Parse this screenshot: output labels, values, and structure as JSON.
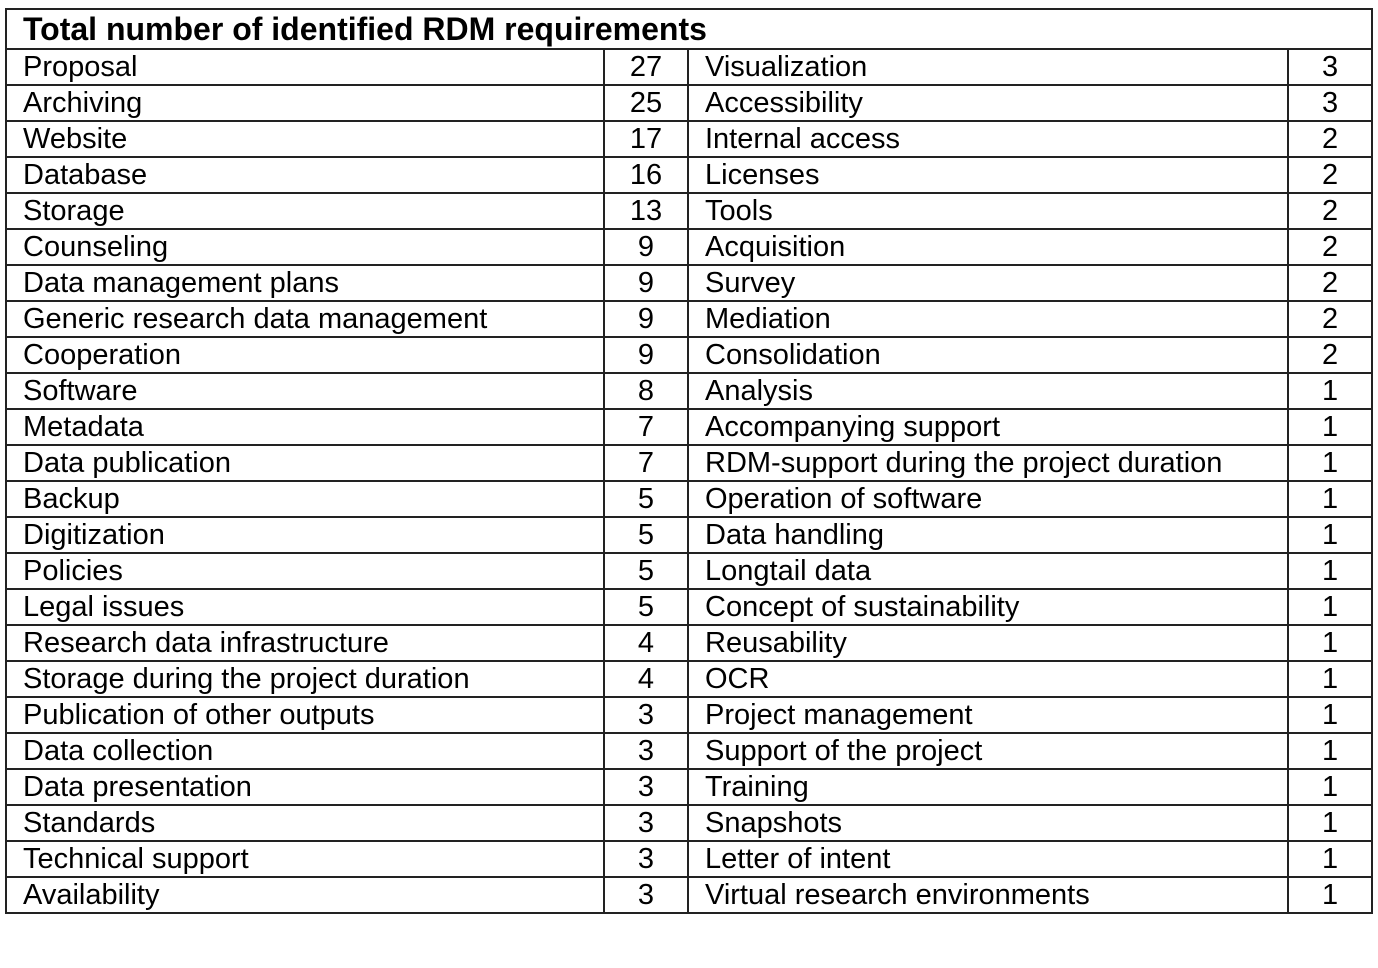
{
  "table": {
    "title": "Total number of identified RDM requirements",
    "rows": [
      {
        "left_label": "Proposal",
        "left_value": "27",
        "right_label": "Visualization",
        "right_value": "3"
      },
      {
        "left_label": "Archiving",
        "left_value": "25",
        "right_label": "Accessibility",
        "right_value": "3"
      },
      {
        "left_label": "Website",
        "left_value": "17",
        "right_label": "Internal access",
        "right_value": "2"
      },
      {
        "left_label": "Database",
        "left_value": "16",
        "right_label": "Licenses",
        "right_value": "2"
      },
      {
        "left_label": "Storage",
        "left_value": "13",
        "right_label": "Tools",
        "right_value": "2"
      },
      {
        "left_label": "Counseling",
        "left_value": "9",
        "right_label": "Acquisition",
        "right_value": "2"
      },
      {
        "left_label": "Data management plans",
        "left_value": "9",
        "right_label": "Survey",
        "right_value": "2"
      },
      {
        "left_label": "Generic research data management",
        "left_value": "9",
        "right_label": "Mediation",
        "right_value": "2"
      },
      {
        "left_label": "Cooperation",
        "left_value": "9",
        "right_label": "Consolidation",
        "right_value": "2"
      },
      {
        "left_label": "Software",
        "left_value": "8",
        "right_label": "Analysis",
        "right_value": "1"
      },
      {
        "left_label": "Metadata",
        "left_value": "7",
        "right_label": "Accompanying support",
        "right_value": "1"
      },
      {
        "left_label": "Data publication",
        "left_value": "7",
        "right_label": "RDM-support during the project duration",
        "right_value": "1"
      },
      {
        "left_label": "Backup",
        "left_value": "5",
        "right_label": "Operation of software",
        "right_value": "1"
      },
      {
        "left_label": "Digitization",
        "left_value": "5",
        "right_label": "Data handling",
        "right_value": "1"
      },
      {
        "left_label": "Policies",
        "left_value": "5",
        "right_label": "Longtail data",
        "right_value": "1"
      },
      {
        "left_label": "Legal issues",
        "left_value": "5",
        "right_label": "Concept of sustainability",
        "right_value": "1"
      },
      {
        "left_label": "Research data infrastructure",
        "left_value": "4",
        "right_label": "Reusability",
        "right_value": "1"
      },
      {
        "left_label": "Storage during the project duration",
        "left_value": "4",
        "right_label": "OCR",
        "right_value": "1"
      },
      {
        "left_label": "Publication of other outputs",
        "left_value": "3",
        "right_label": "Project management",
        "right_value": "1"
      },
      {
        "left_label": "Data collection",
        "left_value": "3",
        "right_label": "Support of the project",
        "right_value": "1"
      },
      {
        "left_label": "Data presentation",
        "left_value": "3",
        "right_label": "Training",
        "right_value": "1"
      },
      {
        "left_label": "Standards",
        "left_value": "3",
        "right_label": "Snapshots",
        "right_value": "1"
      },
      {
        "left_label": "Technical support",
        "left_value": "3",
        "right_label": "Letter of intent",
        "right_value": "1"
      },
      {
        "left_label": "Availability",
        "left_value": "3",
        "right_label": "Virtual research environments",
        "right_value": "1"
      }
    ]
  }
}
